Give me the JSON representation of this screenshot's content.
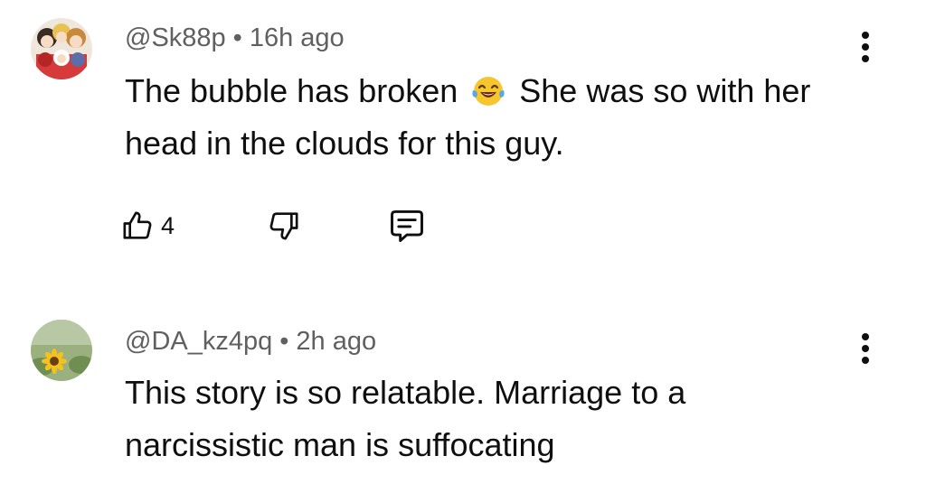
{
  "comments": [
    {
      "handle": "@Sk88p",
      "separator": "•",
      "time": "16h ago",
      "text_before_emoji": "The bubble has broken ",
      "emoji_icon": "tears-of-joy-emoji",
      "text_after_emoji": " She was so with her head in the clouds for this guy.",
      "likes": "4",
      "actions": {
        "like_icon": "thumb-up-icon",
        "dislike_icon": "thumb-down-icon",
        "reply_icon": "reply-comment-icon"
      },
      "more_icon": "more-vertical-icon"
    },
    {
      "handle": "@DA_kz4pq",
      "separator": "•",
      "time": "2h ago",
      "text": "This story is so relatable. Marriage to a narcissistic man is suffocating",
      "more_icon": "more-vertical-icon"
    }
  ]
}
